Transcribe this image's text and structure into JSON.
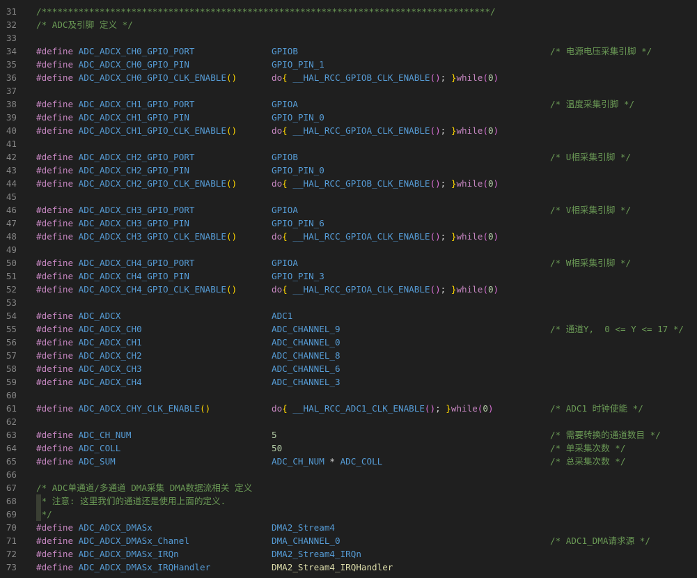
{
  "lines": [
    {
      "n": "31",
      "a": "/*************************************************************************************/",
      "b": "",
      "c": "",
      "type": "comment"
    },
    {
      "n": "32",
      "a": "/* ADC及引脚 定义 */",
      "b": "",
      "c": "",
      "type": "comment"
    },
    {
      "n": "33",
      "a": "",
      "b": "",
      "c": "",
      "type": "blank"
    },
    {
      "n": "34",
      "a": "ADC_ADCX_CH0_GPIO_PORT",
      "b": "GPIOB",
      "c": "/* 电源电压采集引脚 */",
      "type": "define"
    },
    {
      "n": "35",
      "a": "ADC_ADCX_CH0_GPIO_PIN",
      "b": "GPIO_PIN_1",
      "c": "",
      "type": "define"
    },
    {
      "n": "36",
      "a": "ADC_ADCX_CH0_GPIO_CLK_ENABLE",
      "b": "__HAL_RCC_GPIOB_CLK_ENABLE",
      "c": "",
      "type": "clk"
    },
    {
      "n": "37",
      "a": "",
      "b": "",
      "c": "",
      "type": "blank"
    },
    {
      "n": "38",
      "a": "ADC_ADCX_CH1_GPIO_PORT",
      "b": "GPIOA",
      "c": "/* 温度采集引脚 */",
      "type": "define"
    },
    {
      "n": "39",
      "a": "ADC_ADCX_CH1_GPIO_PIN",
      "b": "GPIO_PIN_0",
      "c": "",
      "type": "define"
    },
    {
      "n": "40",
      "a": "ADC_ADCX_CH1_GPIO_CLK_ENABLE",
      "b": "__HAL_RCC_GPIOA_CLK_ENABLE",
      "c": "",
      "type": "clk"
    },
    {
      "n": "41",
      "a": "",
      "b": "",
      "c": "",
      "type": "blank"
    },
    {
      "n": "42",
      "a": "ADC_ADCX_CH2_GPIO_PORT",
      "b": "GPIOB",
      "c": "/* U相采集引脚 */",
      "type": "define"
    },
    {
      "n": "43",
      "a": "ADC_ADCX_CH2_GPIO_PIN",
      "b": "GPIO_PIN_0",
      "c": "",
      "type": "define"
    },
    {
      "n": "44",
      "a": "ADC_ADCX_CH2_GPIO_CLK_ENABLE",
      "b": "__HAL_RCC_GPIOB_CLK_ENABLE",
      "c": "",
      "type": "clk"
    },
    {
      "n": "45",
      "a": "",
      "b": "",
      "c": "",
      "type": "blank"
    },
    {
      "n": "46",
      "a": "ADC_ADCX_CH3_GPIO_PORT",
      "b": "GPIOA",
      "c": "/* V相采集引脚 */",
      "type": "define"
    },
    {
      "n": "47",
      "a": "ADC_ADCX_CH3_GPIO_PIN",
      "b": "GPIO_PIN_6",
      "c": "",
      "type": "define"
    },
    {
      "n": "48",
      "a": "ADC_ADCX_CH3_GPIO_CLK_ENABLE",
      "b": "__HAL_RCC_GPIOA_CLK_ENABLE",
      "c": "",
      "type": "clk"
    },
    {
      "n": "49",
      "a": "",
      "b": "",
      "c": "",
      "type": "blank"
    },
    {
      "n": "50",
      "a": "ADC_ADCX_CH4_GPIO_PORT",
      "b": "GPIOA",
      "c": "/* W相采集引脚 */",
      "type": "define"
    },
    {
      "n": "51",
      "a": "ADC_ADCX_CH4_GPIO_PIN",
      "b": "GPIO_PIN_3",
      "c": "",
      "type": "define"
    },
    {
      "n": "52",
      "a": "ADC_ADCX_CH4_GPIO_CLK_ENABLE",
      "b": "__HAL_RCC_GPIOA_CLK_ENABLE",
      "c": "",
      "type": "clk"
    },
    {
      "n": "53",
      "a": "",
      "b": "",
      "c": "",
      "type": "blank"
    },
    {
      "n": "54",
      "a": "ADC_ADCX",
      "b": "ADC1",
      "c": "",
      "type": "define"
    },
    {
      "n": "55",
      "a": "ADC_ADCX_CH0",
      "b": "ADC_CHANNEL_9",
      "c": "/* 通道Y,  0 <= Y <= 17 */",
      "type": "define"
    },
    {
      "n": "56",
      "a": "ADC_ADCX_CH1",
      "b": "ADC_CHANNEL_0",
      "c": "",
      "type": "define"
    },
    {
      "n": "57",
      "a": "ADC_ADCX_CH2",
      "b": "ADC_CHANNEL_8",
      "c": "",
      "type": "define"
    },
    {
      "n": "58",
      "a": "ADC_ADCX_CH3",
      "b": "ADC_CHANNEL_6",
      "c": "",
      "type": "define"
    },
    {
      "n": "59",
      "a": "ADC_ADCX_CH4",
      "b": "ADC_CHANNEL_3",
      "c": "",
      "type": "define"
    },
    {
      "n": "60",
      "a": "",
      "b": "",
      "c": "",
      "type": "blank"
    },
    {
      "n": "61",
      "a": "ADC_ADCX_CHY_CLK_ENABLE",
      "b": "__HAL_RCC_ADC1_CLK_ENABLE",
      "c": "/* ADC1 时钟使能 */",
      "type": "clk2"
    },
    {
      "n": "62",
      "a": "",
      "b": "",
      "c": "",
      "type": "blank"
    },
    {
      "n": "63",
      "a": "ADC_CH_NUM",
      "b": "5",
      "c": "/* 需要转换的通道数目 */",
      "type": "definenum"
    },
    {
      "n": "64",
      "a": "ADC_COLL",
      "b": "50",
      "c": "/* 单采集次数 */",
      "type": "definenum"
    },
    {
      "n": "65",
      "a": "ADC_SUM",
      "b": "ADC_CH_NUM * ADC_COLL",
      "c": "/* 总采集次数 */",
      "type": "sum"
    },
    {
      "n": "66",
      "a": "",
      "b": "",
      "c": "",
      "type": "blank"
    },
    {
      "n": "67",
      "a": "/* ADC单通道/多通道 DMA采集 DMA数据流相关 定义",
      "b": "",
      "c": "",
      "type": "comment"
    },
    {
      "n": "68",
      "a": " * 注意: 这里我们的通道还是使用上面的定义.",
      "b": "",
      "c": "",
      "type": "commentguide"
    },
    {
      "n": "69",
      "a": " */",
      "b": "",
      "c": "",
      "type": "commentguide"
    },
    {
      "n": "70",
      "a": "ADC_ADCX_DMASx",
      "b": "DMA2_Stream4",
      "c": "",
      "type": "define"
    },
    {
      "n": "71",
      "a": "ADC_ADCX_DMASx_Chanel",
      "b": "DMA_CHANNEL_0",
      "c": "/* ADC1_DMA请求源 */",
      "type": "define"
    },
    {
      "n": "72",
      "a": "ADC_ADCX_DMASx_IRQn",
      "b": "DMA2_Stream4_IRQn",
      "c": "",
      "type": "define"
    },
    {
      "n": "73",
      "a": "ADC_ADCX_DMASx_IRQHandler",
      "b": "DMA2_Stream4_IRQHandler",
      "c": "",
      "type": "handler"
    }
  ],
  "tokens": {
    "define": "#define",
    "do_open": "do{ ",
    "call_close": "(); ",
    "brace_close": "}",
    "while_kw": "while",
    "while_arg": "(0)",
    "param_parens": "()"
  }
}
